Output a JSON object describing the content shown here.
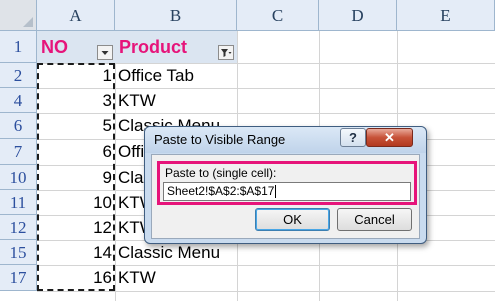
{
  "columns": [
    "A",
    "B",
    "C",
    "D",
    "E"
  ],
  "rows": [
    "1",
    "2",
    "4",
    "6",
    "7",
    "10",
    "11",
    "12",
    "15",
    "17"
  ],
  "headers": {
    "no": "NO",
    "product": "Product"
  },
  "cells": [
    {
      "no": "1",
      "product": "Office Tab"
    },
    {
      "no": "3",
      "product": "KTW"
    },
    {
      "no": "5",
      "product": "Classic Menu"
    },
    {
      "no": "6",
      "product": "Office Tab"
    },
    {
      "no": "9",
      "product": "Classic Menu"
    },
    {
      "no": "10",
      "product": "KTW"
    },
    {
      "no": "12",
      "product": "KTW"
    },
    {
      "no": "14",
      "product": "Classic Menu"
    },
    {
      "no": "16",
      "product": "KTW"
    }
  ],
  "dialog": {
    "title": "Paste to Visible Range",
    "help": "?",
    "close": "✕",
    "field_label": "Paste to (single cell):",
    "field_value": "Sheet2!$A$2:$A$17",
    "ok": "OK",
    "cancel": "Cancel"
  },
  "colors": {
    "header_text": "#e6147a",
    "highlight_border": "#e6147a",
    "row_number": "#2c4f9e"
  }
}
